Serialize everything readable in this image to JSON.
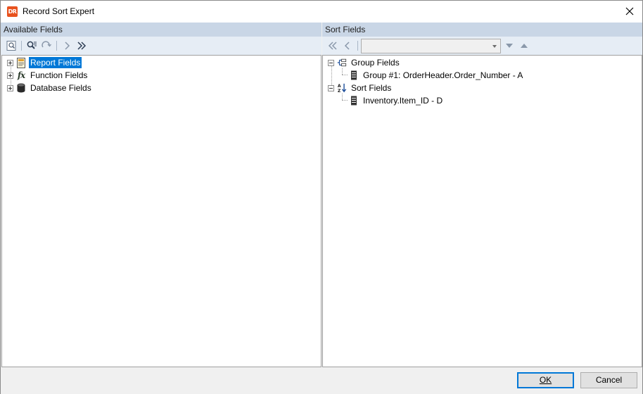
{
  "window": {
    "title": "Record Sort Expert",
    "app_icon_text": "DR"
  },
  "available": {
    "header": "Available Fields",
    "toolbar": [
      "browse-icon",
      "find-icon",
      "find-next-icon",
      "add-icon",
      "add-all-icon"
    ],
    "tree": [
      {
        "label": "Report Fields",
        "icon": "report-icon",
        "selected": true
      },
      {
        "label": "Function Fields",
        "icon": "function-icon",
        "selected": false
      },
      {
        "label": "Database Fields",
        "icon": "database-icon",
        "selected": false
      }
    ]
  },
  "sort": {
    "header": "Sort Fields",
    "toolbar": [
      "remove-all-icon",
      "remove-icon",
      "sort-direction-dropdown",
      "move-down-icon",
      "move-up-icon"
    ],
    "combo_value": "",
    "tree": {
      "group_label": "Group Fields",
      "group_items": [
        "Group #1: OrderHeader.Order_Number - A"
      ],
      "sort_label": "Sort Fields",
      "sort_items": [
        "Inventory.Item_ID - D"
      ]
    }
  },
  "buttons": {
    "ok": "OK",
    "cancel": "Cancel"
  },
  "colors": {
    "header_bg": "#c9d6e6",
    "toolbar_bg": "#e6edf5",
    "selection": "#0078d7",
    "app_icon": "#e8521e"
  }
}
